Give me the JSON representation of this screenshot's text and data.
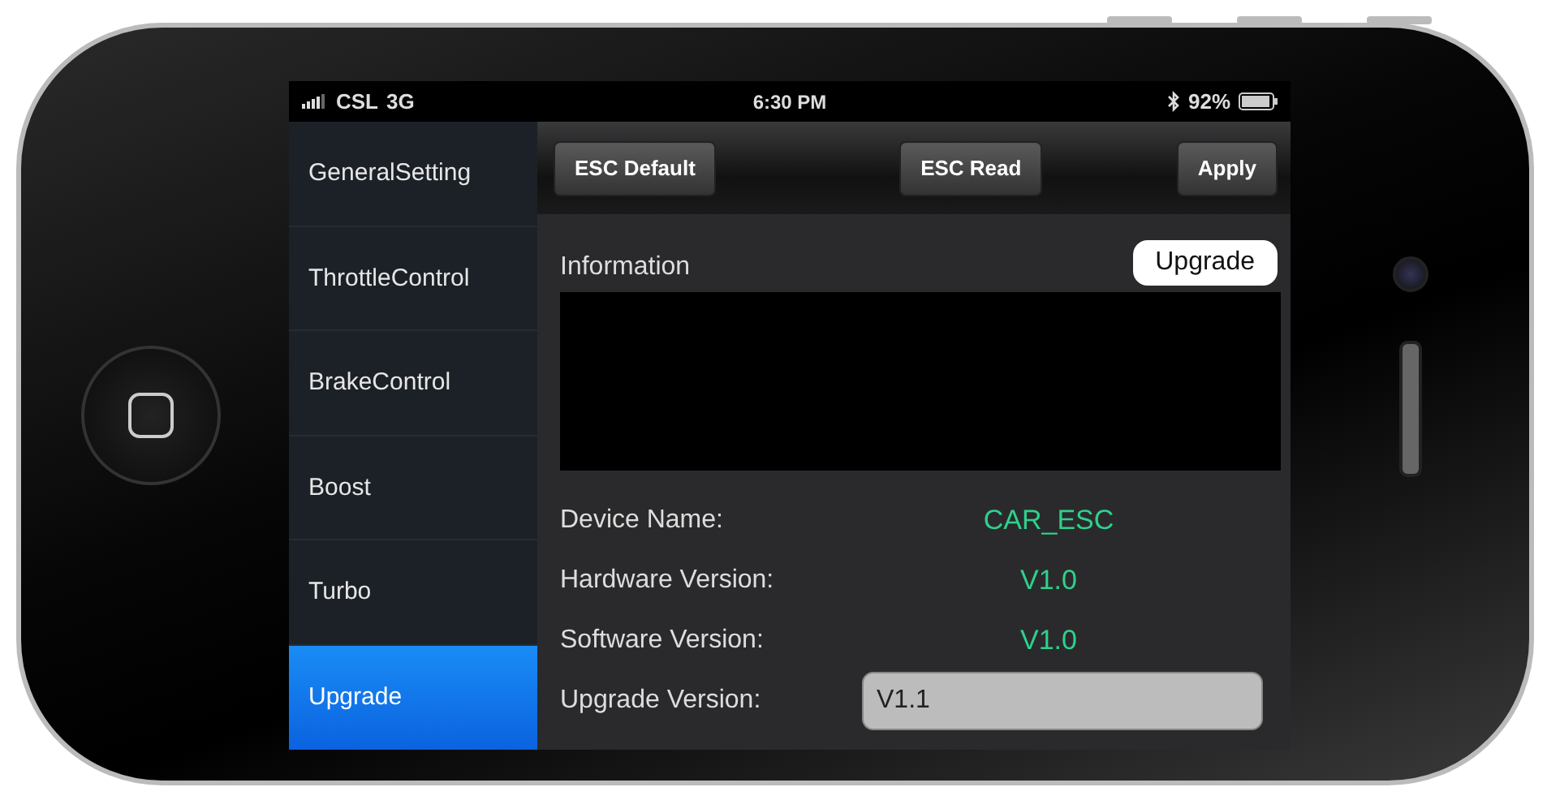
{
  "status_bar": {
    "carrier": "CSL",
    "network": "3G",
    "time": "6:30 PM",
    "battery": "92%"
  },
  "sidebar": {
    "items": [
      {
        "label": "GeneralSetting",
        "selected": false
      },
      {
        "label": "ThrottleControl",
        "selected": false
      },
      {
        "label": "BrakeControl",
        "selected": false
      },
      {
        "label": "Boost",
        "selected": false
      },
      {
        "label": "Turbo",
        "selected": false
      },
      {
        "label": "Upgrade",
        "selected": true
      }
    ]
  },
  "toolbar": {
    "buttons": [
      "ESC Default",
      "ESC Read",
      "Apply"
    ]
  },
  "information": {
    "label": "Information",
    "upgrade_button": "Upgrade"
  },
  "device_info": [
    {
      "kind": "text",
      "label": "Device Name:",
      "value": "CAR_ESC"
    },
    {
      "kind": "text",
      "label": "Hardware Version:",
      "value": "V1.0"
    },
    {
      "kind": "text",
      "label": "Software Version:",
      "value": "V1.0"
    },
    {
      "kind": "field",
      "label": "Upgrade Version:",
      "value": "V1.1"
    }
  ]
}
